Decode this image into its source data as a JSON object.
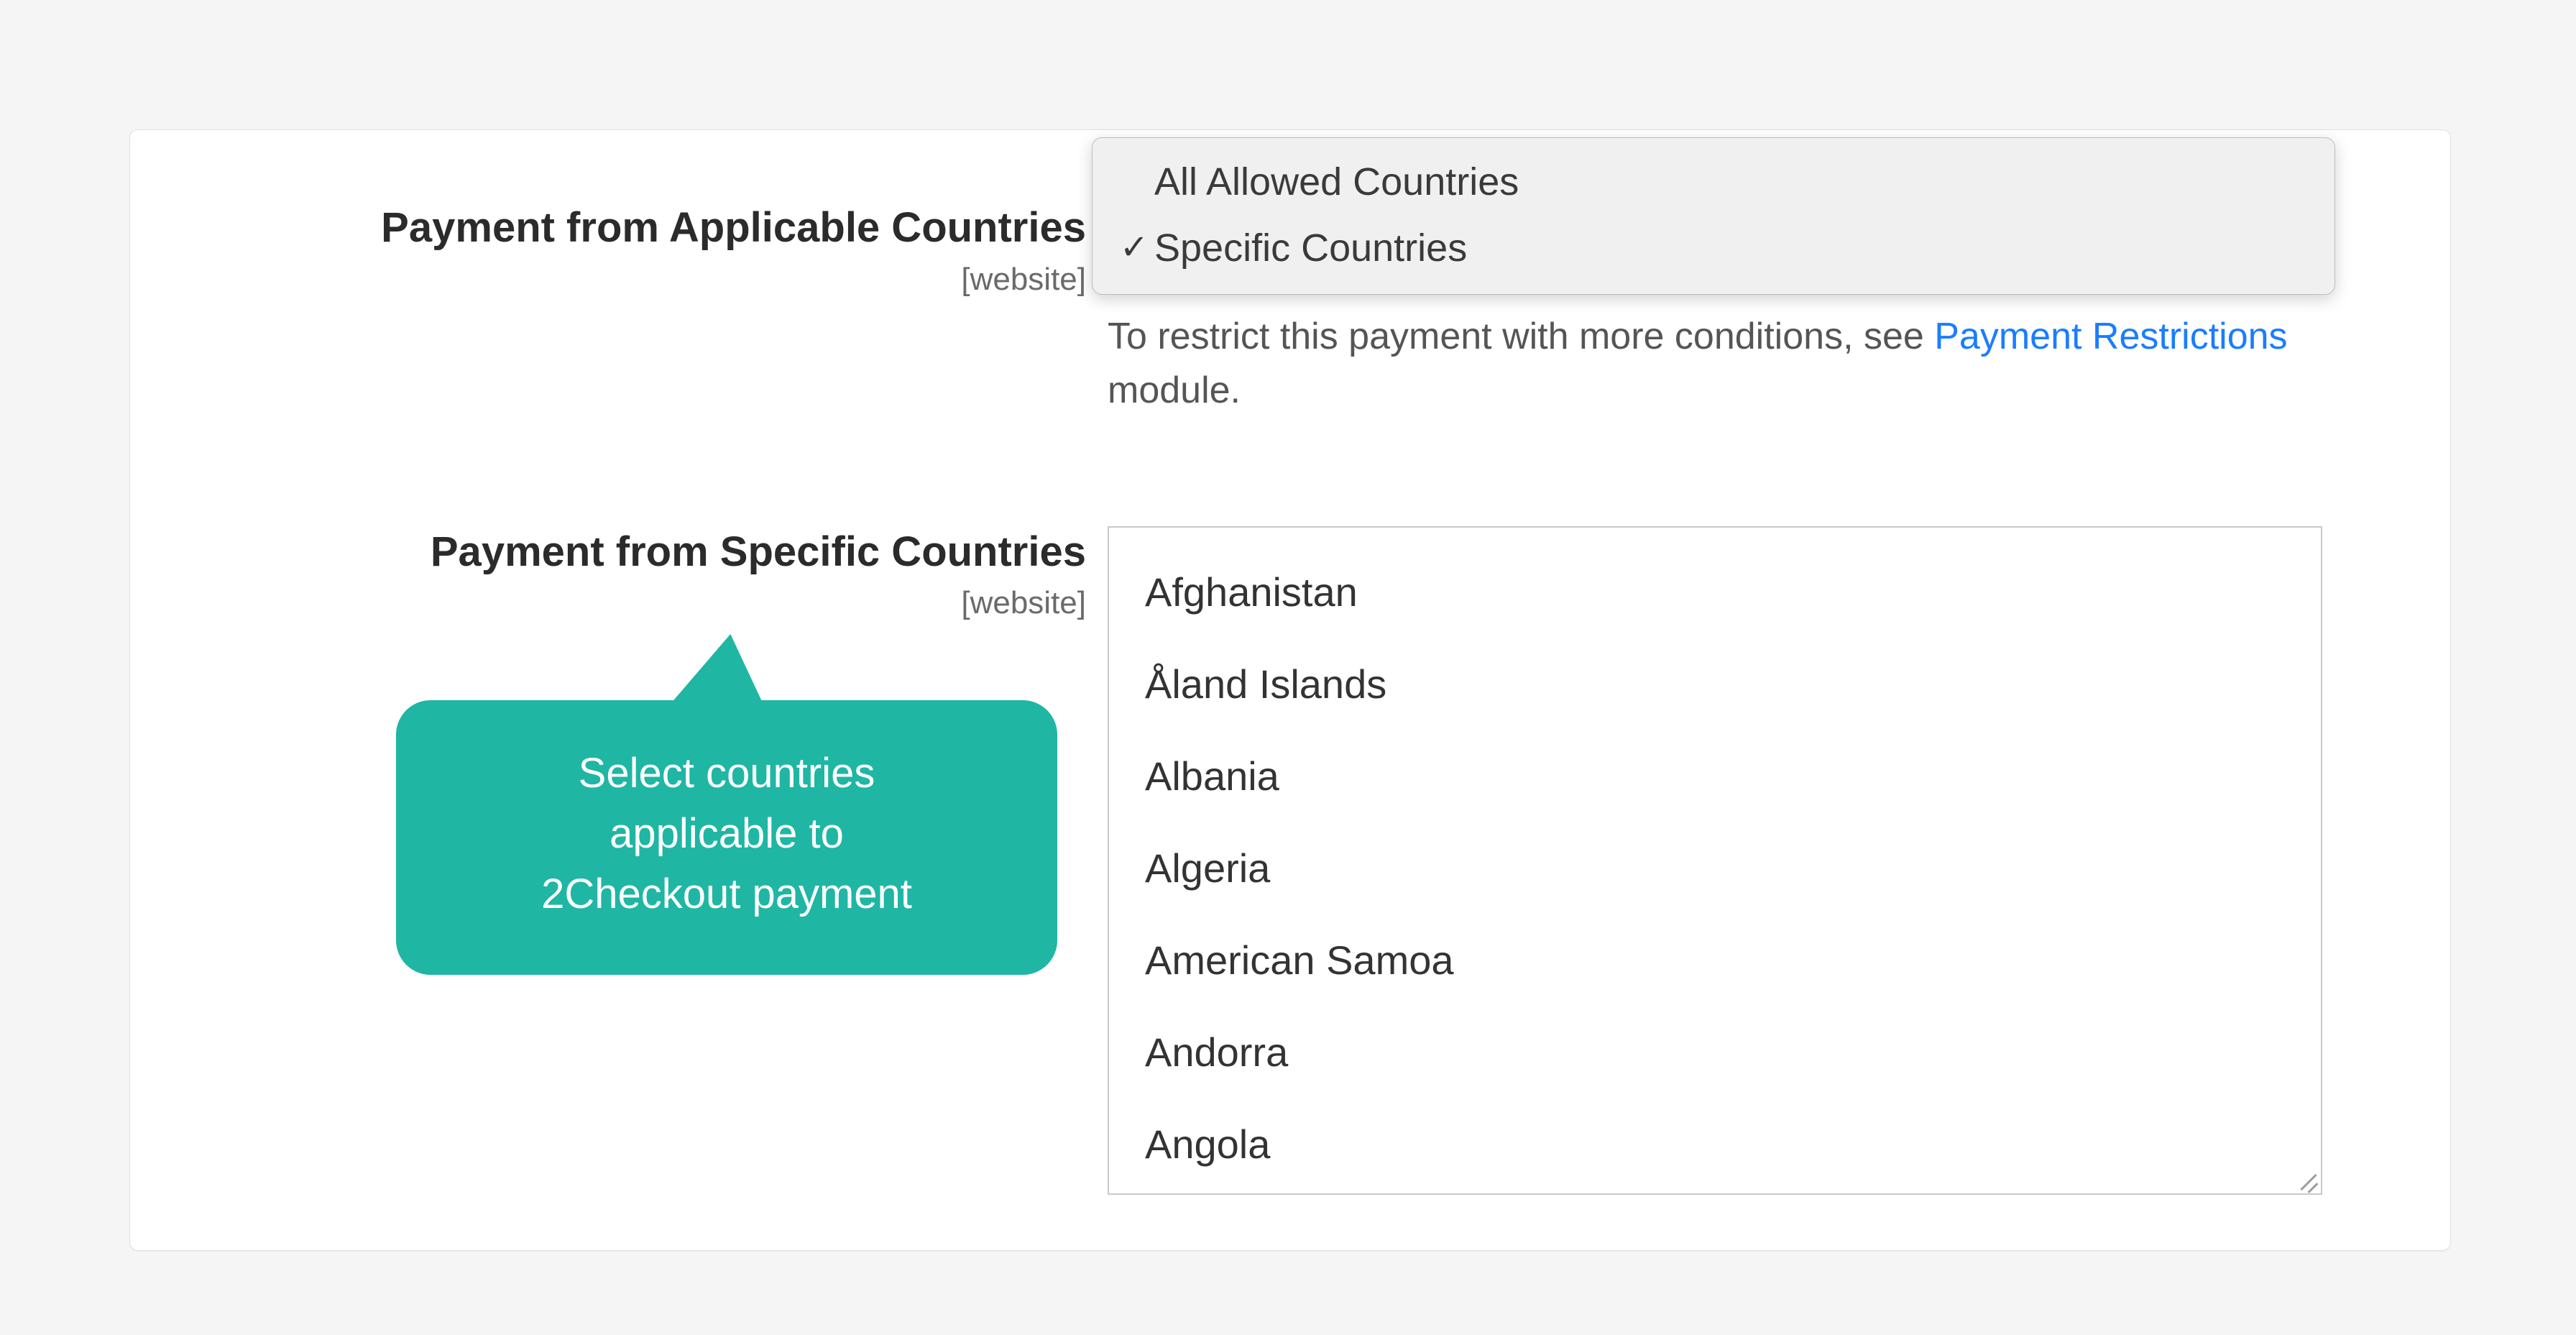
{
  "colors": {
    "accent_link": "#1a7dff",
    "focus_ring": "#3b8cff",
    "callout": "#1fb6a4"
  },
  "applicable": {
    "label": "Payment from Applicable Countries",
    "scope": "[website]",
    "options": [
      {
        "label": "All Allowed Countries",
        "selected": false
      },
      {
        "label": "Specific Countries",
        "selected": true
      }
    ],
    "help_prefix": "To restrict this payment with more conditions, see ",
    "help_link": "Payment Restrictions",
    "help_suffix": " module."
  },
  "specific": {
    "label": "Payment from Specific Countries",
    "scope": "[website]",
    "options": [
      "Afghanistan",
      "Åland Islands",
      "Albania",
      "Algeria",
      "American Samoa",
      "Andorra",
      "Angola"
    ]
  },
  "callout": {
    "line1": "Select countries",
    "line2": "applicable to",
    "line3": "2Checkout payment"
  }
}
